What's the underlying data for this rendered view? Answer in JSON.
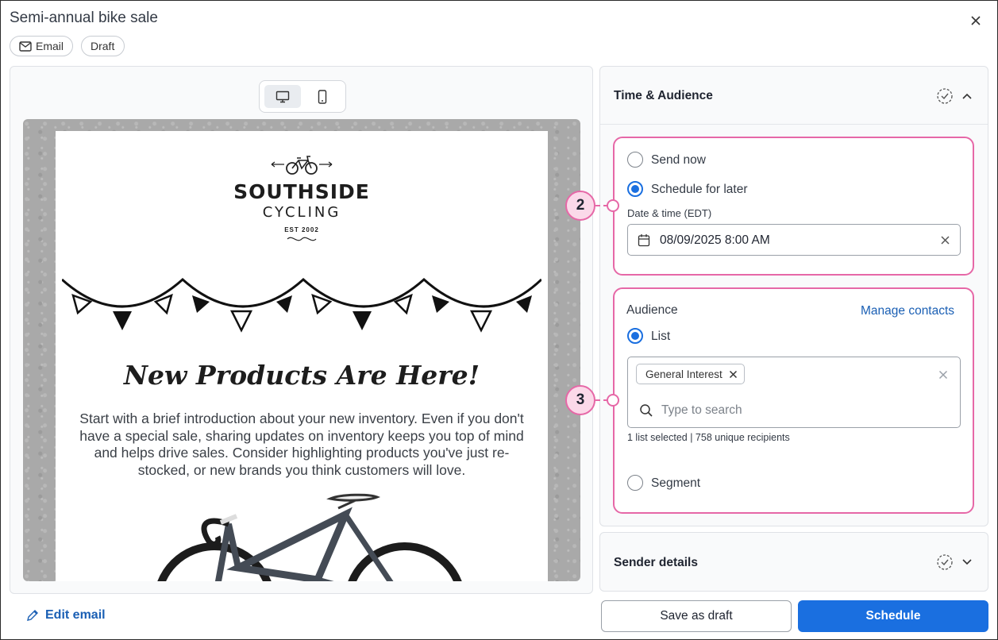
{
  "header": {
    "title": "Semi-annual bike sale",
    "chips": {
      "type": "Email",
      "status": "Draft"
    }
  },
  "preview": {
    "logo": {
      "line1": "SOUTHSIDE",
      "line2": "CYCLING",
      "line3": "EST 2002"
    },
    "headline": "New Products Are Here!",
    "body": "Start with a brief introduction about your new inventory. Even if you don't have a special sale, sharing updates on inventory keeps you top of mind and helps drive sales. Consider highlighting products you've just re-stocked, or new brands you think customers will love."
  },
  "footer": {
    "edit_email": "Edit email",
    "save_draft": "Save as draft",
    "schedule": "Schedule"
  },
  "time_audience": {
    "title": "Time & Audience",
    "send_now": "Send now",
    "schedule_later": "Schedule for later",
    "schedule_later_selected": true,
    "date_label": "Date & time (EDT)",
    "date_value": "08/09/2025 8:00 AM"
  },
  "audience": {
    "label": "Audience",
    "manage_contacts": "Manage contacts",
    "list_option": "List",
    "list_selected": true,
    "tags": [
      "General Interest"
    ],
    "search_placeholder": "Type to search",
    "summary": "1 list selected | 758 unique recipients",
    "segment_option": "Segment"
  },
  "callouts": {
    "time": "2",
    "audience": "3"
  },
  "sender_details": {
    "title": "Sender details"
  },
  "colors": {
    "accent": "#1a6fe0",
    "callout": "#e668a7",
    "link": "#1a5fb4"
  }
}
